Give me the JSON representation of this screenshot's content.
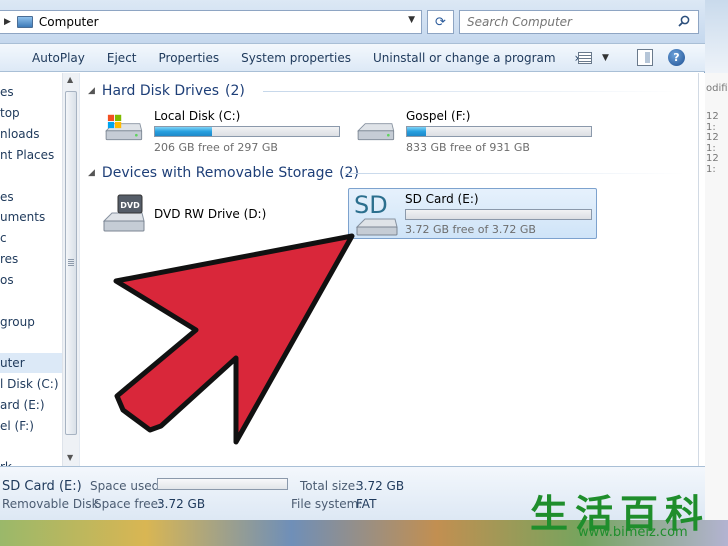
{
  "address": {
    "location": "Computer",
    "refresh_glyph": "⟳"
  },
  "search": {
    "placeholder": "Search Computer"
  },
  "toolbar": {
    "items": [
      "AutoPlay",
      "Eject",
      "Properties",
      "System properties",
      "Uninstall or change a program"
    ],
    "more": "»",
    "help": "?"
  },
  "nav": {
    "items": [
      "es",
      "top",
      "nloads",
      "nt Places",
      "es",
      "uments",
      "c",
      "res",
      "os",
      "group",
      "uter",
      "l Disk (C:)",
      "ard (E:)",
      "el (F:)",
      "rk"
    ]
  },
  "groups": {
    "hdd": {
      "title": "Hard Disk Drives",
      "count": "(2)"
    },
    "removable": {
      "title": "Devices with Removable Storage",
      "count": "(2)"
    }
  },
  "drives": {
    "c": {
      "name": "Local Disk (C:)",
      "free": "206 GB free of 297 GB",
      "used_fraction": 0.31
    },
    "f": {
      "name": "Gospel (F:)",
      "free": "833 GB free of 931 GB",
      "used_fraction": 0.105
    },
    "dvd": {
      "name": "DVD RW Drive (D:)",
      "icon_label": "DVD"
    },
    "e": {
      "name": "SD Card (E:)",
      "free": "3.72 GB free of 3.72 GB",
      "used_fraction": 0.0,
      "icon_label": "SD"
    }
  },
  "details": {
    "name": "SD Card (E:)",
    "type": "Removable Disk",
    "space_used_label": "Space used:",
    "space_free_label": "Space free:",
    "space_free_value": "3.72 GB",
    "total_size_label": "Total size:",
    "total_size_value": "3.72 GB",
    "fs_label": "File system:",
    "fs_value": "FAT"
  },
  "background_text": [
    "odifie",
    "12 1:",
    "12 1:",
    "12 1:"
  ],
  "watermark": {
    "chars": "生活百科",
    "url": "www.bimeiz.com"
  },
  "colors": {
    "arrow_fill": "#d9273a",
    "accent": "#1e3f78",
    "bar_fill": "#279fdf",
    "watermark": "#1f8e2c"
  },
  "icons": {
    "refresh": "refresh-icon",
    "search": "search-icon",
    "help": "help-icon",
    "drive": "hard-drive-icon",
    "dvd": "dvd-drive-icon",
    "sd": "sd-card-icon"
  }
}
